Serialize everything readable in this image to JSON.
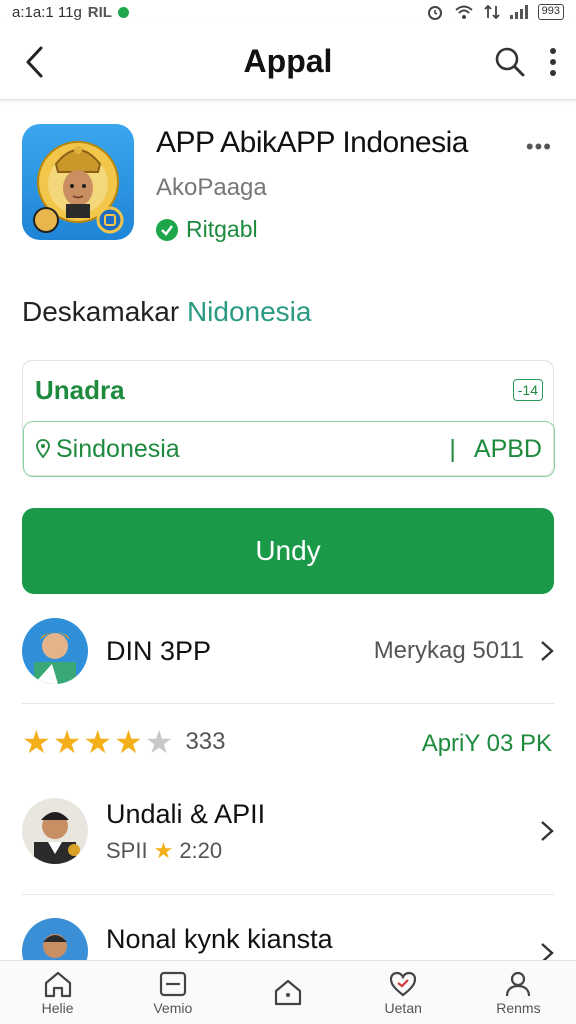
{
  "status_bar": {
    "time": "a:1a:1 11g",
    "carrier": "RIL",
    "battery": "993"
  },
  "app_bar": {
    "title": "Appal",
    "back_icon": "back-arrow-icon",
    "search_icon": "search-icon",
    "menu_icon": "more-vert-icon"
  },
  "app": {
    "name": "APP AbikAPP Indonesia",
    "developer": "AkoPaaga",
    "verified_label": "Ritgabl",
    "more": "•••"
  },
  "section": {
    "prefix": "Deskamakar",
    "accent": "Nidonesia"
  },
  "card": {
    "title": "Unadra",
    "badge": "-14",
    "region_name": "Sindonesia",
    "separator": "|",
    "region_code": "APBD"
  },
  "install_button": {
    "label": "Undy"
  },
  "publisher_row": {
    "name": "DIN 3PP",
    "meta": "Merykag 5011"
  },
  "rating": {
    "stars": 4,
    "max": 5,
    "count": "333",
    "label": "ApriY 03 PK"
  },
  "reviews": [
    {
      "name": "Undali & APII",
      "sub_prefix": "SPII",
      "sub_value": "2:20"
    },
    {
      "name": "Nonal kynk kiansta"
    }
  ],
  "bottom_nav": [
    {
      "label": "Helie",
      "icon": "home-icon"
    },
    {
      "label": "Vemio",
      "icon": "library-icon"
    },
    {
      "label": "",
      "icon": "house-icon"
    },
    {
      "label": "Uetan",
      "icon": "heart-icon"
    },
    {
      "label": "Renms",
      "icon": "profile-icon"
    }
  ],
  "colors": {
    "accent_green": "#1a9a48",
    "teal": "#2a9a82",
    "star": "#f4b01b"
  }
}
